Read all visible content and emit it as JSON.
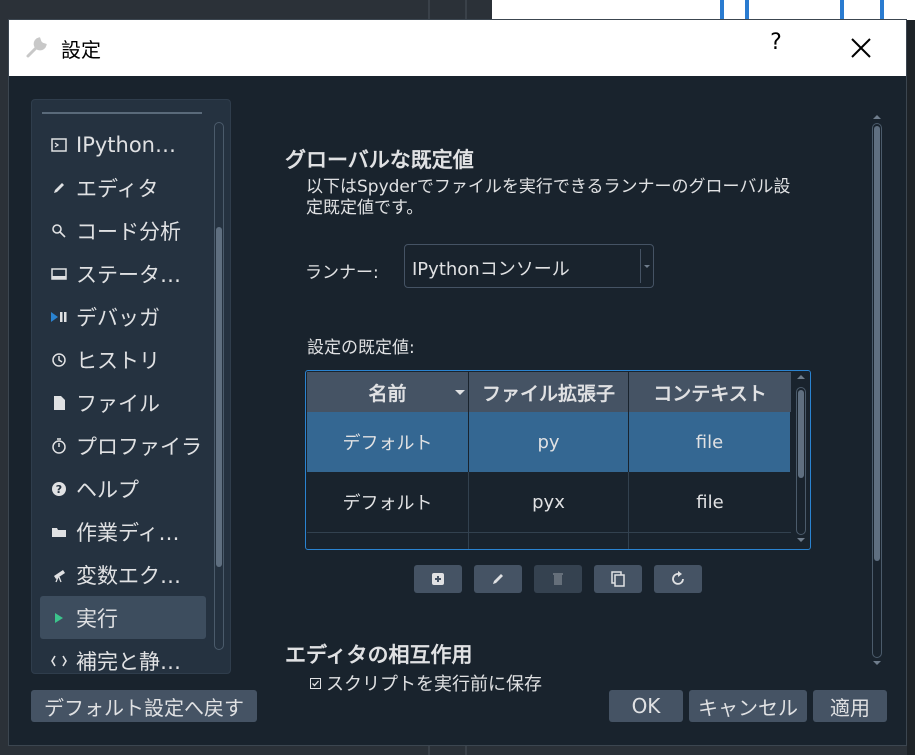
{
  "window": {
    "title": "設定",
    "help_symbol": "?"
  },
  "sidebar": {
    "items": [
      {
        "label": "IPython…",
        "icon": "terminal-icon"
      },
      {
        "label": "エディタ",
        "icon": "pencil-icon"
      },
      {
        "label": "コード分析",
        "icon": "code-analysis-icon"
      },
      {
        "label": "ステータ…",
        "icon": "statusbar-icon"
      },
      {
        "label": "デバッガ",
        "icon": "debug-icon"
      },
      {
        "label": "ヒストリ",
        "icon": "history-icon"
      },
      {
        "label": "ファイル",
        "icon": "file-icon"
      },
      {
        "label": "プロファイラ",
        "icon": "stopwatch-icon"
      },
      {
        "label": "ヘルプ",
        "icon": "help-icon"
      },
      {
        "label": "作業ディ…",
        "icon": "folder-icon"
      },
      {
        "label": "変数エク…",
        "icon": "telescope-icon"
      },
      {
        "label": "実行",
        "icon": "play-icon",
        "selected": true
      },
      {
        "label": "補完と静…",
        "icon": "completion-icon"
      }
    ]
  },
  "content": {
    "global_title": "グローバルな既定値",
    "description": "以下はSpyderでファイルを実行できるランナーのグローバル設定既定値です。",
    "runner_label": "ランナー:",
    "runner_value": "IPythonコンソール",
    "defaults_label": "設定の既定値:",
    "table": {
      "columns": [
        "名前",
        "ファイル拡張子",
        "コンテキスト"
      ],
      "rows": [
        {
          "name": "デフォルト",
          "ext": "py",
          "context": "file",
          "selected": true
        },
        {
          "name": "デフォルト",
          "ext": "pyx",
          "context": "file",
          "selected": false
        }
      ]
    },
    "table_buttons": [
      "add-icon",
      "edit-icon",
      "delete-icon",
      "clone-icon",
      "reset-icon"
    ],
    "editor_title": "エディタの相互作用",
    "save_checkbox_label": "スクリプトを実行前に保存",
    "save_checkbox_checked": true
  },
  "footer": {
    "reset_defaults": "デフォルト設定へ戻す",
    "ok": "OK",
    "cancel": "キャンセル",
    "apply": "適用"
  },
  "colors": {
    "background": "#19232d",
    "selection": "#346792",
    "button": "#455364",
    "accent_border": "#2a83d0",
    "text": "#e0e1e3"
  }
}
